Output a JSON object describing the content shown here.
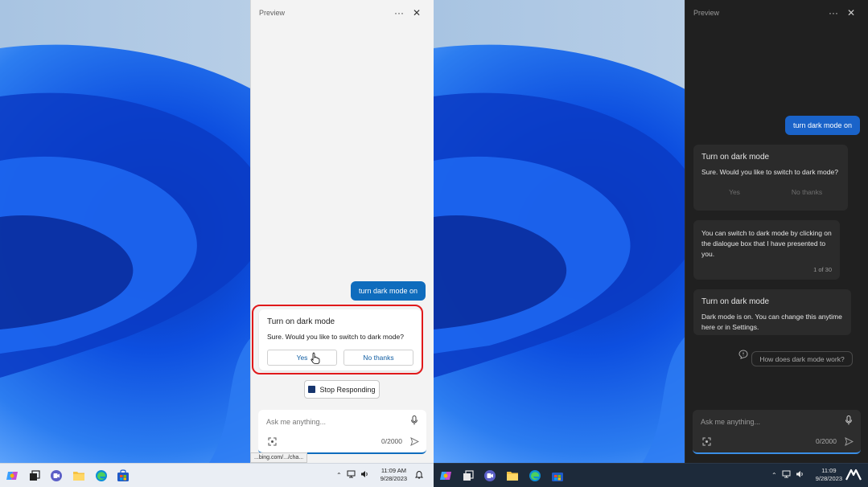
{
  "left": {
    "panel": {
      "title": "Preview",
      "user_message": "turn dark mode on",
      "card": {
        "title": "Turn on dark mode",
        "text": "Sure. Would you like to switch to dark mode?",
        "yes_label": "Yes",
        "no_label": "No thanks"
      },
      "stop_label": "Stop Responding",
      "input_placeholder": "Ask me anything...",
      "char_count": "0/2000",
      "url_tooltip": "...bing.com/.../cha..."
    },
    "taskbar": {
      "time": "11:09 AM",
      "date": "9/28/2023"
    }
  },
  "right": {
    "panel": {
      "title": "Preview",
      "user_message": "turn dark mode on",
      "card1": {
        "title": "Turn on dark mode",
        "text": "Sure. Would you like to switch to dark mode?",
        "yes_label": "Yes",
        "no_label": "No thanks"
      },
      "card2": {
        "text": "You can switch to dark mode by clicking on the dialogue box that I have presented to you.",
        "pager": "1 of 30"
      },
      "card3": {
        "title": "Turn on dark mode",
        "text": "Dark mode is on. You can change this anytime here or in Settings."
      },
      "suggestion": "How does dark mode work?",
      "input_placeholder": "Ask me anything...",
      "char_count": "0/2000"
    },
    "taskbar": {
      "time": "11:09",
      "date": "9/28/2023"
    }
  },
  "colors": {
    "accent": "#0f6cbd",
    "highlight_ring": "#e0191b",
    "dark_panel": "#202020"
  },
  "icons": [
    "more-icon",
    "close-icon",
    "mic-icon",
    "screenshot-icon",
    "send-icon",
    "chat-bubble-icon",
    "copilot-icon",
    "task-view-icon",
    "teams-icon",
    "file-explorer-icon",
    "edge-icon",
    "store-icon",
    "chevron-up-icon",
    "network-icon",
    "volume-icon",
    "bell-icon"
  ]
}
